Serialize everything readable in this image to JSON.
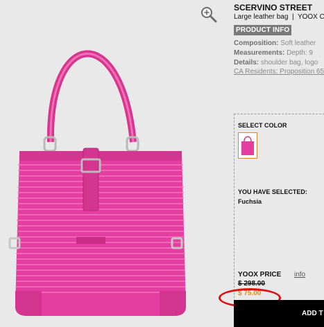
{
  "colors": {
    "background": "#e9e9e9",
    "bag": "#e43fa0",
    "price_sale": "#e08a1e",
    "highlight_circle": "#e01010",
    "button": "#000000"
  },
  "product": {
    "brand": "SCERVINO STREET",
    "subtitle": "Large leather bag",
    "subtitle_extra": "YOOX C",
    "image_alt": "Fuchsia large leather bag"
  },
  "info": {
    "tab_label": "PRODUCT INFO",
    "composition_label": "Composition:",
    "composition_value": " Soft leather",
    "measurements_label": "Measurements:",
    "measurements_value": " Depth: 9",
    "details_label": "Details:",
    "details_value": " shoulder bag, logo",
    "ca_link": "CA Residents: Proposition 65"
  },
  "selection": {
    "select_color_label": "SELECT COLOR",
    "you_selected_label": "YOU HAVE SELECTED:",
    "selected_color": "Fuchsia"
  },
  "pricing": {
    "label": "YOOX PRICE",
    "info_link": "info",
    "original_price": "$ 298.00",
    "sale_price": "$ 75.00"
  },
  "actions": {
    "add_label": "ADD T"
  },
  "icons": {
    "zoom": "zoom-in-icon"
  }
}
